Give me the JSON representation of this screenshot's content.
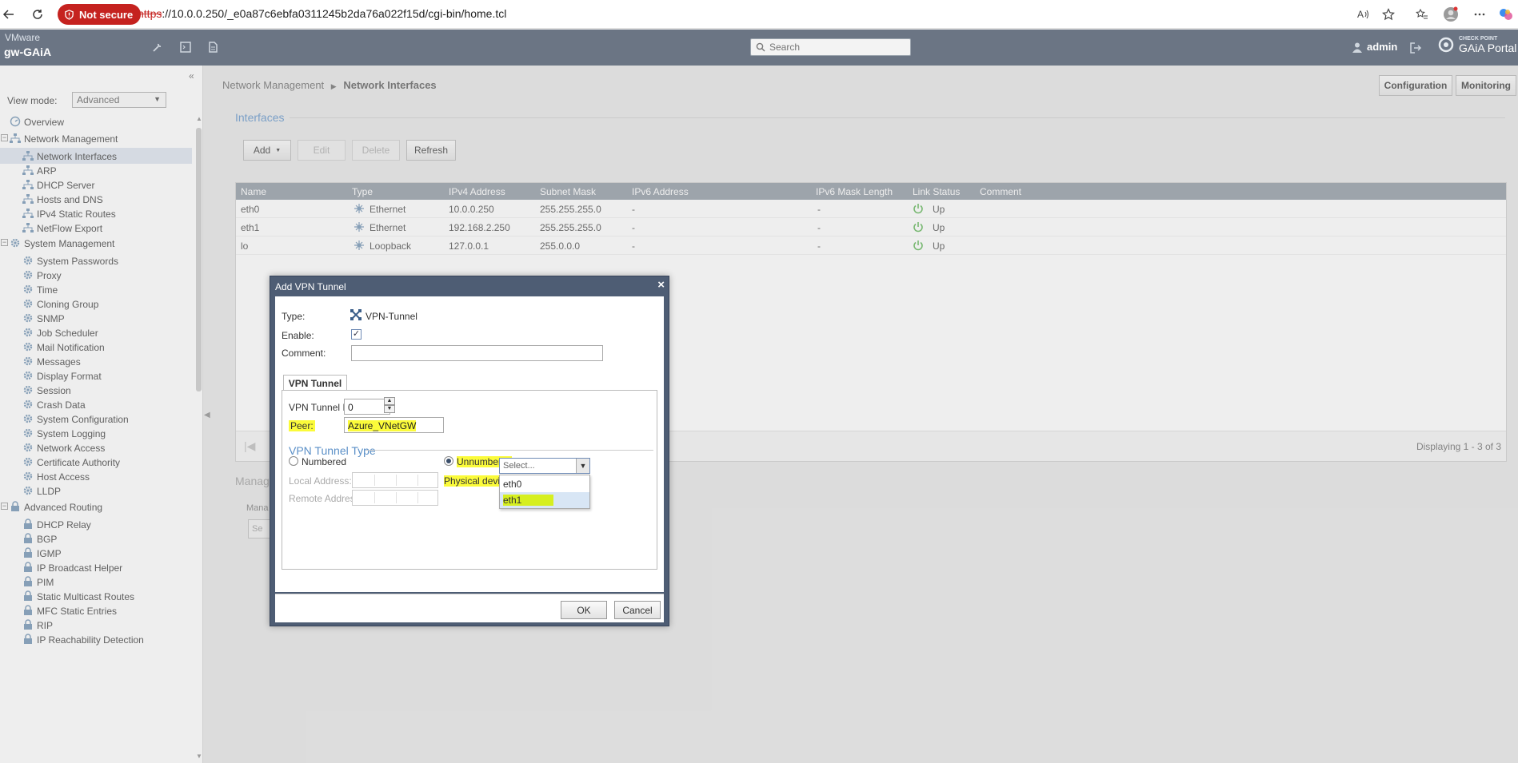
{
  "browser": {
    "not_secure": "Not secure",
    "url_scheme": "https",
    "url_rest": "://10.0.0.250/_e0a87c6ebfa0311245b2da76a022f15d/cgi-bin/home.tcl"
  },
  "header": {
    "vendor": "VMware",
    "hostname": "gw-GAiA",
    "search_placeholder": "Search",
    "user": "admin",
    "portal_small_1": "CHECK POINT",
    "portal_big": "GAiA Portal"
  },
  "sidebar": {
    "view_mode_label": "View mode:",
    "view_mode_value": "Advanced",
    "items": [
      {
        "label": "Overview"
      },
      {
        "label": "Network Management"
      },
      {
        "label": "Network Interfaces"
      },
      {
        "label": "ARP"
      },
      {
        "label": "DHCP Server"
      },
      {
        "label": "Hosts and DNS"
      },
      {
        "label": "IPv4 Static Routes"
      },
      {
        "label": "NetFlow Export"
      },
      {
        "label": "System Management"
      },
      {
        "label": "System Passwords"
      },
      {
        "label": "Proxy"
      },
      {
        "label": "Time"
      },
      {
        "label": "Cloning Group"
      },
      {
        "label": "SNMP"
      },
      {
        "label": "Job Scheduler"
      },
      {
        "label": "Mail Notification"
      },
      {
        "label": "Messages"
      },
      {
        "label": "Display Format"
      },
      {
        "label": "Session"
      },
      {
        "label": "Crash Data"
      },
      {
        "label": "System Configuration"
      },
      {
        "label": "System Logging"
      },
      {
        "label": "Network Access"
      },
      {
        "label": "Certificate Authority"
      },
      {
        "label": "Host Access"
      },
      {
        "label": "LLDP"
      },
      {
        "label": "Advanced Routing"
      },
      {
        "label": "DHCP Relay"
      },
      {
        "label": "BGP"
      },
      {
        "label": "IGMP"
      },
      {
        "label": "IP Broadcast Helper"
      },
      {
        "label": "PIM"
      },
      {
        "label": "Static Multicast Routes"
      },
      {
        "label": "MFC Static Entries"
      },
      {
        "label": "RIP"
      },
      {
        "label": "IP Reachability Detection"
      }
    ]
  },
  "main": {
    "breadcrumb_parent": "Network Management",
    "breadcrumb_current": "Network Interfaces",
    "configuration": "Configuration",
    "monitoring": "Monitoring",
    "section_title": "Interfaces",
    "toolbar": {
      "add": "Add",
      "edit": "Edit",
      "delete": "Delete",
      "refresh": "Refresh"
    },
    "columns": [
      "Name",
      "Type",
      "IPv4 Address",
      "Subnet Mask",
      "IPv6 Address",
      "IPv6 Mask Length",
      "Link Status",
      "Comment"
    ],
    "rows": [
      {
        "name": "eth0",
        "type": "Ethernet",
        "ipv4": "10.0.0.250",
        "mask": "255.255.255.0",
        "ipv6": "-",
        "ipv6len": "-",
        "status": "Up"
      },
      {
        "name": "eth1",
        "type": "Ethernet",
        "ipv4": "192.168.2.250",
        "mask": "255.255.255.0",
        "ipv6": "-",
        "ipv6len": "-",
        "status": "Up"
      },
      {
        "name": "lo",
        "type": "Loopback",
        "ipv4": "127.0.0.1",
        "mask": "255.0.0.0",
        "ipv6": "-",
        "ipv6len": "-",
        "status": "Up"
      }
    ],
    "displaying": "Displaying 1 - 3 of 3",
    "manage_title": "Manag",
    "manage_sub": "Mana",
    "manage_btn": "Se"
  },
  "dialog": {
    "title": "Add VPN Tunnel",
    "type_label": "Type:",
    "type_value": "VPN-Tunnel",
    "enable_label": "Enable:",
    "comment_label": "Comment:",
    "comment_value": "",
    "tab": "VPN Tunnel",
    "tunnel_id_label": "VPN Tunnel ID:",
    "tunnel_id_value": "0",
    "peer_label": "Peer:",
    "peer_value": "Azure_VNetGW",
    "tunnel_type_title": "VPN Tunnel Type",
    "numbered": "Numbered",
    "unnumbered": "Unnumbered",
    "local_address": "Local Address:",
    "remote_address": "Remote Address:",
    "physical_device": "Physical device:",
    "physical_placeholder": "Select...",
    "options": [
      "eth0",
      "eth1"
    ],
    "ok": "OK",
    "cancel": "Cancel"
  }
}
